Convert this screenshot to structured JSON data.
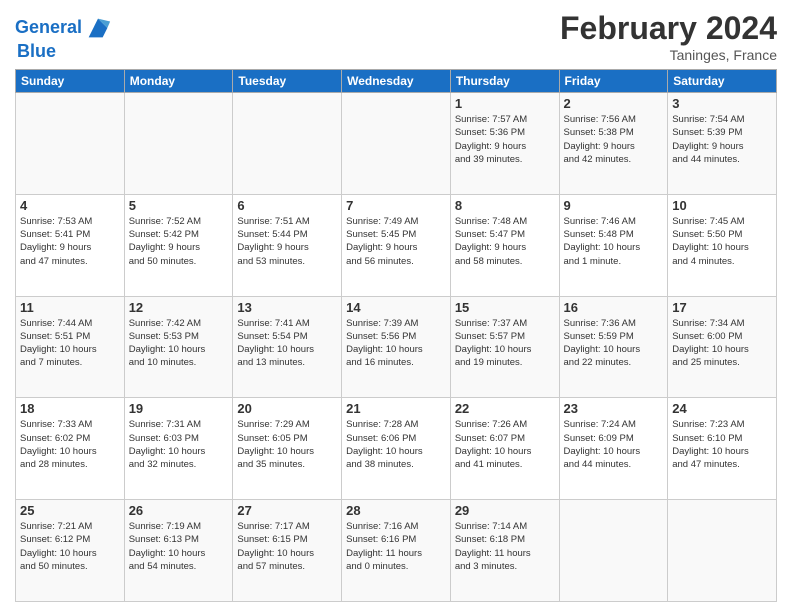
{
  "header": {
    "logo_line1": "General",
    "logo_line2": "Blue",
    "month": "February 2024",
    "location": "Taninges, France"
  },
  "weekdays": [
    "Sunday",
    "Monday",
    "Tuesday",
    "Wednesday",
    "Thursday",
    "Friday",
    "Saturday"
  ],
  "weeks": [
    [
      {
        "day": "",
        "info": ""
      },
      {
        "day": "",
        "info": ""
      },
      {
        "day": "",
        "info": ""
      },
      {
        "day": "",
        "info": ""
      },
      {
        "day": "1",
        "info": "Sunrise: 7:57 AM\nSunset: 5:36 PM\nDaylight: 9 hours\nand 39 minutes."
      },
      {
        "day": "2",
        "info": "Sunrise: 7:56 AM\nSunset: 5:38 PM\nDaylight: 9 hours\nand 42 minutes."
      },
      {
        "day": "3",
        "info": "Sunrise: 7:54 AM\nSunset: 5:39 PM\nDaylight: 9 hours\nand 44 minutes."
      }
    ],
    [
      {
        "day": "4",
        "info": "Sunrise: 7:53 AM\nSunset: 5:41 PM\nDaylight: 9 hours\nand 47 minutes."
      },
      {
        "day": "5",
        "info": "Sunrise: 7:52 AM\nSunset: 5:42 PM\nDaylight: 9 hours\nand 50 minutes."
      },
      {
        "day": "6",
        "info": "Sunrise: 7:51 AM\nSunset: 5:44 PM\nDaylight: 9 hours\nand 53 minutes."
      },
      {
        "day": "7",
        "info": "Sunrise: 7:49 AM\nSunset: 5:45 PM\nDaylight: 9 hours\nand 56 minutes."
      },
      {
        "day": "8",
        "info": "Sunrise: 7:48 AM\nSunset: 5:47 PM\nDaylight: 9 hours\nand 58 minutes."
      },
      {
        "day": "9",
        "info": "Sunrise: 7:46 AM\nSunset: 5:48 PM\nDaylight: 10 hours\nand 1 minute."
      },
      {
        "day": "10",
        "info": "Sunrise: 7:45 AM\nSunset: 5:50 PM\nDaylight: 10 hours\nand 4 minutes."
      }
    ],
    [
      {
        "day": "11",
        "info": "Sunrise: 7:44 AM\nSunset: 5:51 PM\nDaylight: 10 hours\nand 7 minutes."
      },
      {
        "day": "12",
        "info": "Sunrise: 7:42 AM\nSunset: 5:53 PM\nDaylight: 10 hours\nand 10 minutes."
      },
      {
        "day": "13",
        "info": "Sunrise: 7:41 AM\nSunset: 5:54 PM\nDaylight: 10 hours\nand 13 minutes."
      },
      {
        "day": "14",
        "info": "Sunrise: 7:39 AM\nSunset: 5:56 PM\nDaylight: 10 hours\nand 16 minutes."
      },
      {
        "day": "15",
        "info": "Sunrise: 7:37 AM\nSunset: 5:57 PM\nDaylight: 10 hours\nand 19 minutes."
      },
      {
        "day": "16",
        "info": "Sunrise: 7:36 AM\nSunset: 5:59 PM\nDaylight: 10 hours\nand 22 minutes."
      },
      {
        "day": "17",
        "info": "Sunrise: 7:34 AM\nSunset: 6:00 PM\nDaylight: 10 hours\nand 25 minutes."
      }
    ],
    [
      {
        "day": "18",
        "info": "Sunrise: 7:33 AM\nSunset: 6:02 PM\nDaylight: 10 hours\nand 28 minutes."
      },
      {
        "day": "19",
        "info": "Sunrise: 7:31 AM\nSunset: 6:03 PM\nDaylight: 10 hours\nand 32 minutes."
      },
      {
        "day": "20",
        "info": "Sunrise: 7:29 AM\nSunset: 6:05 PM\nDaylight: 10 hours\nand 35 minutes."
      },
      {
        "day": "21",
        "info": "Sunrise: 7:28 AM\nSunset: 6:06 PM\nDaylight: 10 hours\nand 38 minutes."
      },
      {
        "day": "22",
        "info": "Sunrise: 7:26 AM\nSunset: 6:07 PM\nDaylight: 10 hours\nand 41 minutes."
      },
      {
        "day": "23",
        "info": "Sunrise: 7:24 AM\nSunset: 6:09 PM\nDaylight: 10 hours\nand 44 minutes."
      },
      {
        "day": "24",
        "info": "Sunrise: 7:23 AM\nSunset: 6:10 PM\nDaylight: 10 hours\nand 47 minutes."
      }
    ],
    [
      {
        "day": "25",
        "info": "Sunrise: 7:21 AM\nSunset: 6:12 PM\nDaylight: 10 hours\nand 50 minutes."
      },
      {
        "day": "26",
        "info": "Sunrise: 7:19 AM\nSunset: 6:13 PM\nDaylight: 10 hours\nand 54 minutes."
      },
      {
        "day": "27",
        "info": "Sunrise: 7:17 AM\nSunset: 6:15 PM\nDaylight: 10 hours\nand 57 minutes."
      },
      {
        "day": "28",
        "info": "Sunrise: 7:16 AM\nSunset: 6:16 PM\nDaylight: 11 hours\nand 0 minutes."
      },
      {
        "day": "29",
        "info": "Sunrise: 7:14 AM\nSunset: 6:18 PM\nDaylight: 11 hours\nand 3 minutes."
      },
      {
        "day": "",
        "info": ""
      },
      {
        "day": "",
        "info": ""
      }
    ]
  ]
}
